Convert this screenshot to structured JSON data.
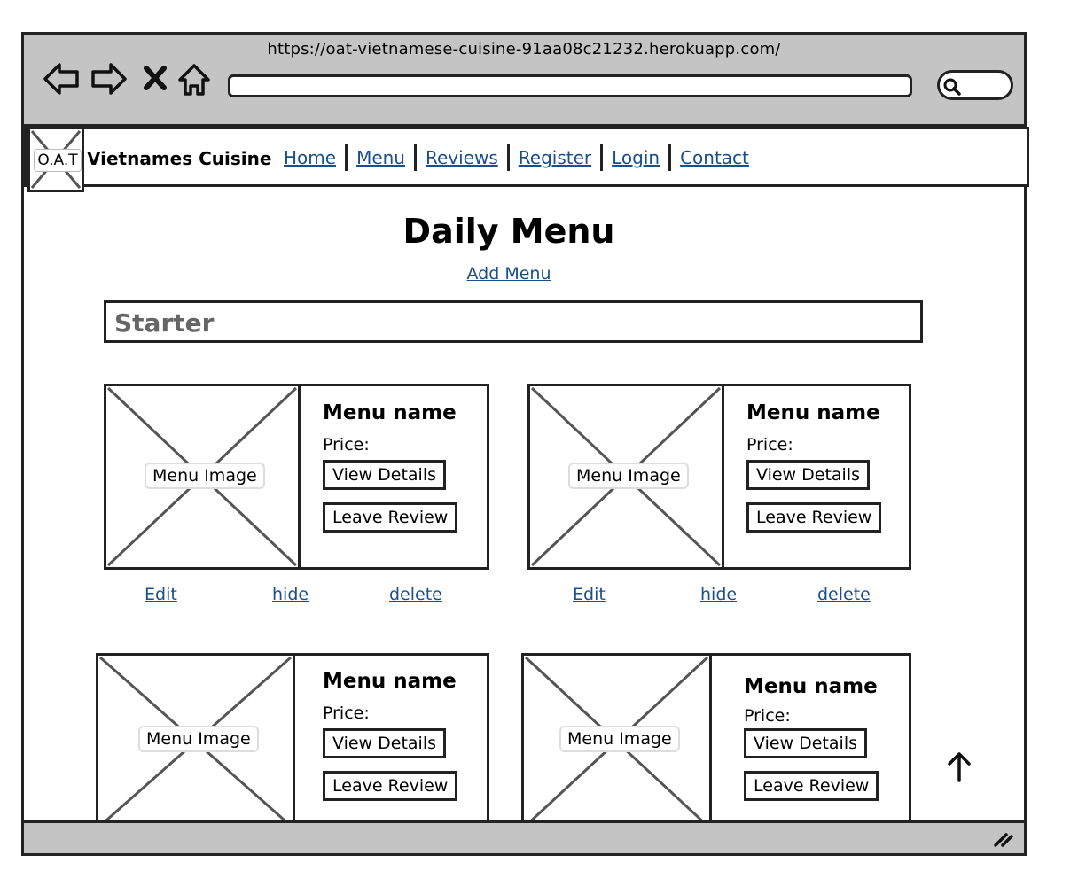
{
  "browser": {
    "url": "https://oat-vietnamese-cuisine-91aa08c21232.herokuapp.com/",
    "icons": [
      "back-icon",
      "forward-icon",
      "close-icon",
      "home-icon",
      "search-icon"
    ]
  },
  "navbar": {
    "logo_text": "O.A.T",
    "brand": "Vietnames Cuisine",
    "links": [
      "Home",
      "Menu",
      "Reviews",
      "Register",
      "Login",
      "Contact"
    ]
  },
  "main": {
    "title": "Daily Menu",
    "add_menu": "Add Menu",
    "section": "Starter",
    "cards": [
      {
        "image_label": "Menu Image",
        "name": "Menu name",
        "price": "Price:",
        "view": "View Details",
        "review": "Leave Review"
      },
      {
        "image_label": "Menu Image",
        "name": "Menu name",
        "price": "Price:",
        "view": "View Details",
        "review": "Leave Review"
      },
      {
        "image_label": "Menu Image",
        "name": "Menu name",
        "price": "Price:",
        "view": "View Details",
        "review": "Leave Review"
      },
      {
        "image_label": "Menu Image",
        "name": "Menu name",
        "price": "Price:",
        "view": "View Details",
        "review": "Leave Review"
      }
    ],
    "actions": [
      {
        "edit": "Edit",
        "hide": "hide",
        "delete": "delete"
      },
      {
        "edit": "Edit",
        "hide": "hide",
        "delete": "delete"
      }
    ]
  },
  "colors": {
    "chrome": "#c4c4c4",
    "link": "#1a4f8c",
    "border": "#222222"
  }
}
